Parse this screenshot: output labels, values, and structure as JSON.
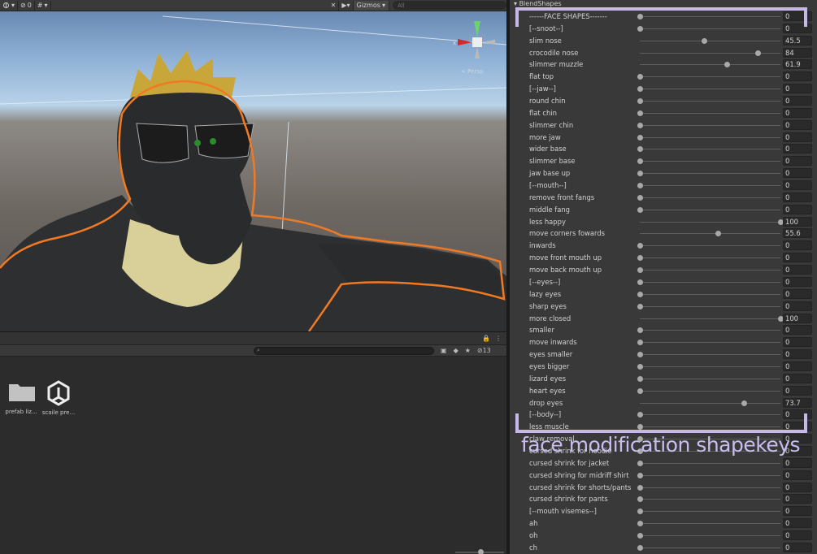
{
  "scene": {
    "toolbar": {
      "hidden_count": "0",
      "gizmos_label": "Gizmos",
      "search_placeholder": "All"
    },
    "perspective_label": "< Persp"
  },
  "project": {
    "hidden_count": "13",
    "assets": [
      {
        "name": "prefab liz...",
        "icon": "folder-icon"
      },
      {
        "name": "scaile pre...",
        "icon": "unity-prefab-icon"
      }
    ]
  },
  "inspector": {
    "section_title": "BlendShapes",
    "blendshapes": [
      {
        "label": "------FACE SHAPES-------",
        "value": "0",
        "level": 0
      },
      {
        "label": "[--snoot--]",
        "value": "0",
        "level": 0
      },
      {
        "label": "slim nose",
        "value": "45.5",
        "level": 45.5
      },
      {
        "label": "crocodile nose",
        "value": "84",
        "level": 84
      },
      {
        "label": "slimmer muzzle",
        "value": "61.9",
        "level": 61.9
      },
      {
        "label": "flat top",
        "value": "0",
        "level": 0
      },
      {
        "label": "[--jaw--]",
        "value": "0",
        "level": 0
      },
      {
        "label": "round chin",
        "value": "0",
        "level": 0
      },
      {
        "label": "flat chin",
        "value": "0",
        "level": 0
      },
      {
        "label": "slimmer chin",
        "value": "0",
        "level": 0
      },
      {
        "label": "more jaw",
        "value": "0",
        "level": 0
      },
      {
        "label": "wider base",
        "value": "0",
        "level": 0
      },
      {
        "label": "slimmer base",
        "value": "0",
        "level": 0
      },
      {
        "label": "jaw base up",
        "value": "0",
        "level": 0
      },
      {
        "label": "[--mouth--]",
        "value": "0",
        "level": 0
      },
      {
        "label": "remove front fangs",
        "value": "0",
        "level": 0
      },
      {
        "label": "middle fang",
        "value": "0",
        "level": 0
      },
      {
        "label": "less happy",
        "value": "100",
        "level": 100
      },
      {
        "label": "move corners fowards",
        "value": "55.6",
        "level": 55.6
      },
      {
        "label": "inwards",
        "value": "0",
        "level": 0
      },
      {
        "label": "move front mouth up",
        "value": "0",
        "level": 0
      },
      {
        "label": "move back mouth up",
        "value": "0",
        "level": 0
      },
      {
        "label": "[--eyes--]",
        "value": "0",
        "level": 0
      },
      {
        "label": "lazy eyes",
        "value": "0",
        "level": 0
      },
      {
        "label": "sharp eyes",
        "value": "0",
        "level": 0
      },
      {
        "label": "more closed",
        "value": "100",
        "level": 100
      },
      {
        "label": "smaller",
        "value": "0",
        "level": 0
      },
      {
        "label": "move inwards",
        "value": "0",
        "level": 0
      },
      {
        "label": "eyes smaller",
        "value": "0",
        "level": 0
      },
      {
        "label": "eyes bigger",
        "value": "0",
        "level": 0
      },
      {
        "label": "lizard eyes",
        "value": "0",
        "level": 0
      },
      {
        "label": "heart eyes",
        "value": "0",
        "level": 0
      },
      {
        "label": "drop eyes",
        "value": "73.7",
        "level": 73.7
      },
      {
        "label": "[--body--]",
        "value": "0",
        "level": 0
      },
      {
        "label": "less muscle",
        "value": "0",
        "level": 0
      },
      {
        "label": "claw removal",
        "value": "0",
        "level": 0
      },
      {
        "label": "cursed shrink for hoodie",
        "value": "0",
        "level": 0
      },
      {
        "label": "cursed shrink for jacket",
        "value": "0",
        "level": 0
      },
      {
        "label": "cursed shring for midriff shirt",
        "value": "0",
        "level": 0
      },
      {
        "label": "cursed shrink for shorts/pants",
        "value": "0",
        "level": 0
      },
      {
        "label": "cursed shrink for pants",
        "value": "0",
        "level": 0
      },
      {
        "label": "[--mouth visemes--]",
        "value": "0",
        "level": 0
      },
      {
        "label": "ah",
        "value": "0",
        "level": 0
      },
      {
        "label": "oh",
        "value": "0",
        "level": 0
      },
      {
        "label": "ch",
        "value": "0",
        "level": 0
      }
    ]
  },
  "annotation": {
    "text": "face modification shapekeys",
    "color": "#c7b8ea"
  }
}
